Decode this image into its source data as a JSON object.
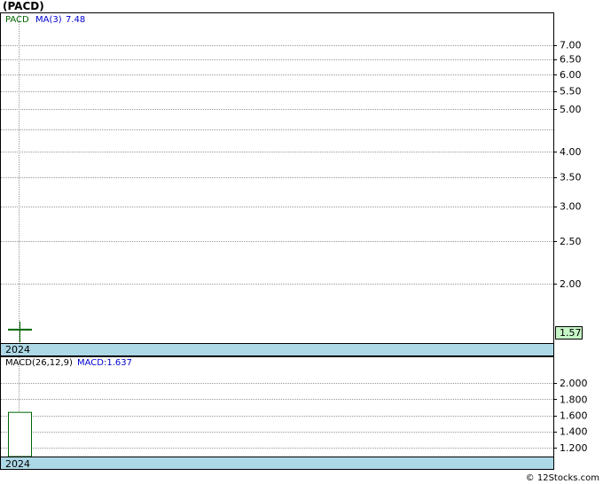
{
  "header": {
    "title": "(PACD)"
  },
  "footer": {
    "watermark": "© 12Stocks.com"
  },
  "chart_data": [
    {
      "type": "line",
      "panel": "price",
      "legend": {
        "symbol": "PACD",
        "ma_label": "MA(3)",
        "ma_value": "7.48"
      },
      "y_scale": "log",
      "ylim": [
        1.47,
        8.0
      ],
      "y_ticks": [
        "7.00",
        "6.50",
        "6.00",
        "5.50",
        "5.00",
        "4.00",
        "3.50",
        "3.00",
        "2.50",
        "2.00"
      ],
      "y_tick_values": [
        7.0,
        6.5,
        6.0,
        5.5,
        5.0,
        4.0,
        3.5,
        3.0,
        2.5,
        2.0
      ],
      "extra_gridlines": [
        4.5
      ],
      "x_label": "2024",
      "candle": {
        "open": 1.57,
        "high": 1.64,
        "low": 1.47,
        "close": 1.57
      },
      "last_price": "1.57",
      "grid": true,
      "colors": {
        "price": "#006400",
        "ma": "#0000cd",
        "axis_band": "#add8e6",
        "price_box": "#c6f5c6"
      }
    },
    {
      "type": "bar",
      "panel": "macd",
      "legend": {
        "label": "MACD(26,12,9)",
        "macd_label": "MACD:1.637"
      },
      "ylim": [
        1.1,
        2.2
      ],
      "y_ticks": [
        "2.000",
        "1.800",
        "1.600",
        "1.400",
        "1.200"
      ],
      "y_tick_values": [
        2.0,
        1.8,
        1.6,
        1.4,
        1.2
      ],
      "x_label": "2024",
      "bars": [
        1.637
      ],
      "grid": true,
      "colors": {
        "bar": "#006400",
        "axis_band": "#add8e6"
      }
    }
  ]
}
